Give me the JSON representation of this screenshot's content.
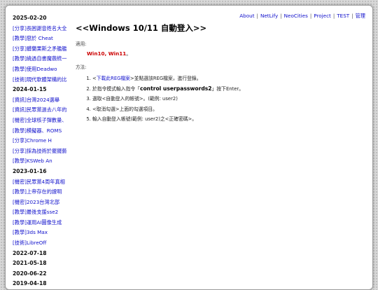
{
  "nav": {
    "items": [
      "About",
      "NetLify",
      "NeoCities",
      "Project",
      "TEST",
      "管理"
    ]
  },
  "sidebar": {
    "groups": [
      {
        "date": "2025-02-20",
        "posts": [
          {
            "tag": "[分享]",
            "title": "長困謝音姓名大全"
          },
          {
            "tag": "[教學]",
            "title": "惡於 Cheat"
          },
          {
            "tag": "[分享]",
            "title": "髒蘭果斯之矛艦艦"
          },
          {
            "tag": "[教學]",
            "title": "繞過自書魔薇統一"
          },
          {
            "tag": "[教學]",
            "title": "使用Deadwo"
          },
          {
            "tag": "[技術]",
            "title": "現代軟體架構的比"
          }
        ]
      },
      {
        "date": "2024-01-15",
        "posts": [
          {
            "tag": "[資訊]",
            "title": "台灣2024選舉"
          },
          {
            "tag": "[資訊]",
            "title": "民眾黨過去八年的"
          },
          {
            "tag": "[機密]",
            "title": "全球核子彈數量、"
          },
          {
            "tag": "[教學]",
            "title": "模擬器、ROMS"
          },
          {
            "tag": "[分享]",
            "title": "Chrome H"
          },
          {
            "tag": "[分享]",
            "title": "採為技術於擺擺藝"
          },
          {
            "tag": "[教學]",
            "title": "KSWeb An"
          }
        ]
      },
      {
        "date": "2023-01-16",
        "posts": [
          {
            "tag": "[機密]",
            "title": "民眾黨4周年真相"
          },
          {
            "tag": "[教學]",
            "title": "上帝存在的證明"
          },
          {
            "tag": "[機密]",
            "title": "2023台灣北部"
          },
          {
            "tag": "[教學]",
            "title": "最後支援sse2"
          },
          {
            "tag": "[教學]",
            "title": "運用AI圖像生成"
          },
          {
            "tag": "[教學]",
            "title": "3ds Max"
          },
          {
            "tag": "[技術]",
            "title": "LibreOff"
          }
        ]
      },
      {
        "date": "2022-07-18",
        "posts": []
      },
      {
        "date": "2021-05-18",
        "posts": []
      },
      {
        "date": "2020-06-22",
        "posts": []
      },
      {
        "date": "2019-04-18",
        "posts": []
      }
    ]
  },
  "article": {
    "title": "<<Windows 10/11 自動登入>>",
    "applies_label": "適用:",
    "applies_value": "Win10, Win11",
    "applies_suffix": "。",
    "method_label": "方法:",
    "steps": [
      {
        "parts": [
          {
            "text": "<",
            "kind": "plain"
          },
          {
            "text": "下載此REG檔案",
            "kind": "link"
          },
          {
            "text": ">並點選該REG檔案，進行登錄。",
            "kind": "plain"
          }
        ]
      },
      {
        "parts": [
          {
            "text": "於指令模式輸入指令「",
            "kind": "plain"
          },
          {
            "text": "control userpasswords2",
            "kind": "cmd"
          },
          {
            "text": "」按下Enter。",
            "kind": "plain"
          }
        ]
      },
      {
        "parts": [
          {
            "text": "選取<自動登入的帳號>。(範例: user2)",
            "kind": "plain"
          }
        ]
      },
      {
        "parts": [
          {
            "text": "<取消勾選>上面的勾選項目。",
            "kind": "plain"
          }
        ]
      },
      {
        "parts": [
          {
            "text": "輸入自動登入帳號(範例: user2)之<正確密碼>。",
            "kind": "plain"
          }
        ]
      }
    ]
  }
}
